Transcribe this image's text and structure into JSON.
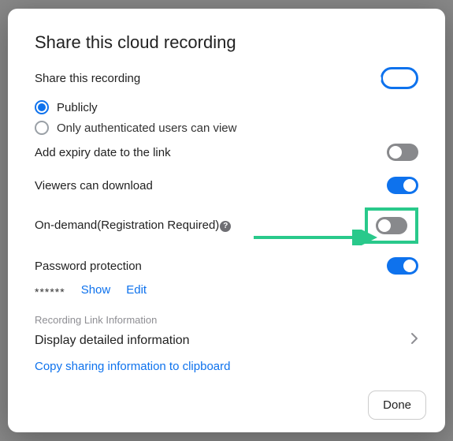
{
  "title": "Share this cloud recording",
  "settings": {
    "share_recording": {
      "label": "Share this recording",
      "enabled": true,
      "options": {
        "public": "Publicly",
        "authenticated": "Only authenticated users can view",
        "selected": "public"
      }
    },
    "expiry": {
      "label": "Add expiry date to the link",
      "enabled": false
    },
    "download": {
      "label": "Viewers can download",
      "enabled": true
    },
    "on_demand": {
      "label": "On-demand(Registration Required)",
      "help_glyph": "?",
      "enabled": false
    },
    "password": {
      "label": "Password protection",
      "enabled": true,
      "mask": "******",
      "show_label": "Show",
      "edit_label": "Edit"
    }
  },
  "link_info": {
    "section": "Recording Link Information",
    "detail": "Display detailed information",
    "copy": "Copy sharing information to clipboard"
  },
  "footer": {
    "done": "Done"
  }
}
